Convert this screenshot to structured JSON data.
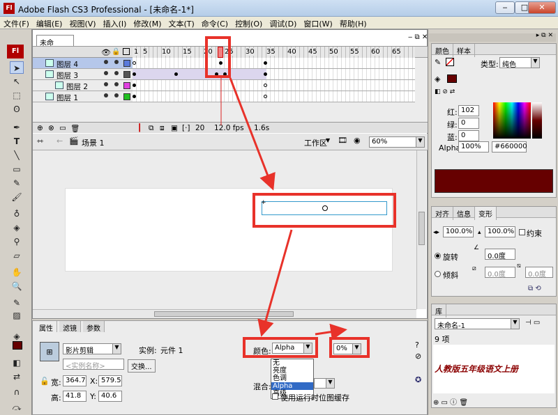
{
  "app": {
    "title": "Adobe Flash CS3 Professional - [未命名-1*]",
    "logo": "Fl"
  },
  "menu": [
    "文件(F)",
    "编辑(E)",
    "视图(V)",
    "插入(I)",
    "修改(M)",
    "文本(T)",
    "命令(C)",
    "控制(O)",
    "调试(D)",
    "窗口(W)",
    "帮助(H)"
  ],
  "doc_tab": "未命名-1*",
  "timeline": {
    "ruler": [
      "1",
      "5",
      "10",
      "15",
      "20",
      "25",
      "30",
      "35",
      "40",
      "45",
      "50",
      "55",
      "60",
      "65"
    ],
    "layers": [
      "图层 4",
      "图层 3",
      "图层 2",
      "图层 1"
    ],
    "frame": "20",
    "fps": "12.0 fps",
    "time": "1.6s"
  },
  "editbar": {
    "scene": "场景 1",
    "workspace": "工作区",
    "zoom": "60%"
  },
  "props": {
    "tabs": [
      "属性",
      "滤镜",
      "参数"
    ],
    "symbol_type": "影片剪辑",
    "instance_label": "实例:",
    "instance_value": "元件 1",
    "instance_name_placeholder": "<实例名称>",
    "swap_btn": "交换...",
    "w_label": "宽:",
    "w": "364.7",
    "x_label": "X:",
    "x": "579.5",
    "h_label": "高:",
    "h": "41.8",
    "y_label": "Y:",
    "y": "40.6",
    "color_label": "颜色:",
    "color_value": "Alpha",
    "alpha_value": "0%",
    "color_options": [
      "无",
      "亮度",
      "色调",
      "Alpha",
      "高级"
    ],
    "blend_label": "混合:",
    "cache_label": "使用运行时位图缓存"
  },
  "color_panel": {
    "tabs": [
      "颜色",
      "样本"
    ],
    "type_label": "类型:",
    "type_value": "纯色",
    "r_label": "红:",
    "r": "102",
    "g_label": "绿:",
    "g": "0",
    "b_label": "蓝:",
    "b": "0",
    "alpha_label": "Alpha:",
    "alpha": "100%",
    "hex": "#660000",
    "swatch": "#660000"
  },
  "transform_panel": {
    "tabs": [
      "对齐",
      "信息",
      "变形"
    ],
    "sx": "100.0%",
    "sy": "100.0%",
    "constrain": "约束",
    "rotate_label": "旋转",
    "rotate": "0.0度",
    "skew_label": "倾斜",
    "skew1": "0.0度",
    "skew2": "0.0度"
  },
  "library_panel": {
    "tab": "库",
    "doc": "未命名-1",
    "count": "9 项",
    "preview_text": "人教版五年级语文上册"
  }
}
